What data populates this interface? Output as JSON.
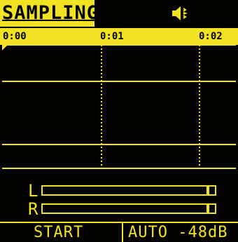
{
  "header": {
    "title": "SAMPLING",
    "speaker_icon": "speaker-icon"
  },
  "timeline": {
    "ticks": [
      "0:00",
      "0:01",
      "0:02"
    ]
  },
  "meters": {
    "left_label": "L",
    "right_label": "R",
    "left_level": 0,
    "right_level": 0
  },
  "softkeys": {
    "left": "START",
    "right": "AUTO -48dB"
  },
  "colors": {
    "foreground": "#f2e224",
    "background": "#050300"
  }
}
